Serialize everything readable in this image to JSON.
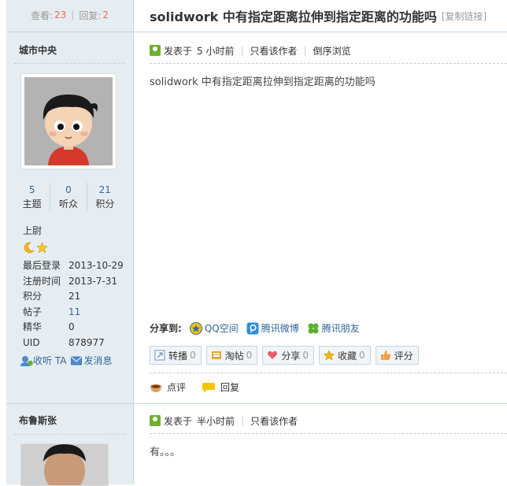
{
  "header": {
    "views_label": "查看:",
    "views_count": "23",
    "sep": "|",
    "replies_label": "回复:",
    "replies_count": "2",
    "title": "solidwork 中有指定距离拉伸到指定距离的功能吗",
    "copy_link": "[复制链接]"
  },
  "post1": {
    "author": "城市中央",
    "stats": [
      {
        "value": "5",
        "label": "主题"
      },
      {
        "value": "0",
        "label": "听众"
      },
      {
        "value": "21",
        "label": "积分"
      }
    ],
    "rank": "上尉",
    "info": [
      {
        "key": "最后登录",
        "value": "2013-10-29"
      },
      {
        "key": "注册时间",
        "value": "2013-7-31"
      },
      {
        "key": "积分",
        "value": "21"
      },
      {
        "key": "帖子",
        "value": "11"
      },
      {
        "key": "精华",
        "value": "0"
      },
      {
        "key": "UID",
        "value": "878977"
      }
    ],
    "listen_label": "收听 TA",
    "message_label": "发消息",
    "posted_prefix": "发表于",
    "posted_time": "5 小时前",
    "author_only": "只看该作者",
    "reverse": "倒序浏览",
    "content": "solidwork 中有指定距离拉伸到指定距离的功能吗",
    "share_label": "分享到:",
    "share": [
      "QQ空间",
      "腾讯微博",
      "腾讯朋友"
    ],
    "buttons": [
      {
        "label": "转播",
        "count": "0",
        "color": "#6B8FB5"
      },
      {
        "label": "淘帖",
        "count": "0",
        "color": "#E8A23C"
      },
      {
        "label": "分享",
        "count": "0",
        "color": "#E85A6A"
      },
      {
        "label": "收藏",
        "count": "0",
        "color": "#F5B800"
      },
      {
        "label": "评分",
        "count": "",
        "color": "#F0A040"
      }
    ],
    "comment_label": "点评",
    "reply_label": "回复"
  },
  "post2": {
    "author": "布鲁斯张",
    "posted_prefix": "发表于",
    "posted_time": "半小时前",
    "author_only": "只看该作者",
    "content": "有。。。"
  },
  "colors": {
    "sidebar_bg": "#E5EDF2",
    "link": "#336699",
    "count_red": "#F26C4F"
  }
}
